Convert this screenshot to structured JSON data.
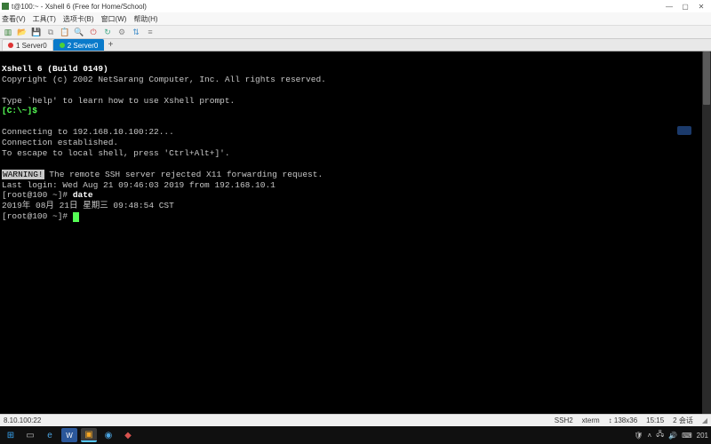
{
  "titlebar": {
    "title": "t@100:~ - Xshell 6 (Free for Home/School)",
    "min": "—",
    "max": "▢",
    "close": "✕"
  },
  "menubar": {
    "items": [
      "查看(V)",
      "工具(T)",
      "选项卡(B)",
      "窗口(W)",
      "帮助(H)"
    ]
  },
  "tabs": {
    "t0": "1 Server0",
    "t1": "2 Server0",
    "plus": "+"
  },
  "terminal": {
    "line1": "Xshell 6 (Build 0149)",
    "line2": "Copyright (c) 2002 NetSarang Computer, Inc. All rights reserved.",
    "blank": "",
    "line3": "Type `help' to learn how to use Xshell prompt.",
    "line4a": "[C:\\~]$",
    "line4b": " ",
    "line5": "Connecting to 192.168.10.100:22...",
    "line6": "Connection established.",
    "line7": "To escape to local shell, press 'Ctrl+Alt+]'.",
    "line8a": "WARNING!",
    "line8b": " The remote SSH server rejected X11 forwarding request.",
    "line9": "Last login: Wed Aug 21 09:46:03 2019 from 192.168.10.1",
    "line10a": "[root@100 ~]# ",
    "line10b": "date",
    "line11": "2019年 08月 21日 星期三 09:48:54 CST",
    "line12": "[root@100 ~]# "
  },
  "statusbar": {
    "left": "8.10.100:22",
    "ssh": "SSH2",
    "term": "xterm",
    "size": "↕ 138x36",
    "time": "15:15",
    "sess": "2 会话"
  },
  "tray": {
    "time": "201"
  },
  "colors": {
    "tab_active_bg": "#0a7aca",
    "prompt_green": "#55ff55"
  }
}
